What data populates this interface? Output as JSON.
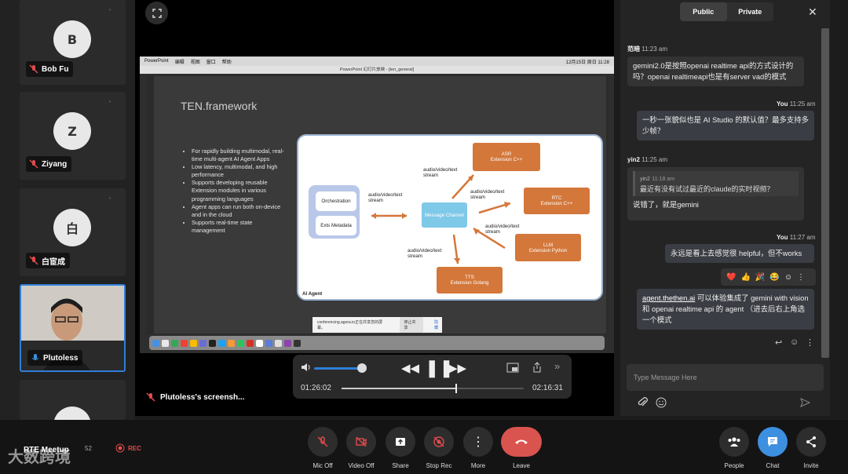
{
  "participants": [
    {
      "initial": "B",
      "name": "Bob Fu"
    },
    {
      "initial": "Z",
      "name": "Ziyang"
    },
    {
      "initial": "白",
      "name": "白宦成"
    },
    {
      "initial": "",
      "name": "Plutoless"
    }
  ],
  "slide": {
    "mac_menu": [
      "PowerPoint",
      "编辑",
      "视图",
      "窗口",
      "帮助"
    ],
    "mac_clock": "12月15日 周日 11:28",
    "window_title": "PowerPoint 幻灯片放映 - [ten_general]",
    "title": "TEN.framework",
    "bullets": [
      "For rapidly building multimodal, real-time multi-agent AI Agent Apps",
      "Low latency, multimodal, and high performance",
      "Supports developing reusable Extension modules in various programming languages",
      "Agent apps can run both on-device and in the cloud",
      "Supports real-time state management"
    ],
    "diagram": {
      "orchestration": "Orchestration",
      "exts_metadata": "Exts Metadata",
      "message_channel": "Message Channel",
      "asr": "ASR",
      "asr_sub": "Extension C++",
      "rtc": "RTC",
      "rtc_sub": "Extension C++",
      "llm": "LLM",
      "llm_sub": "Extension Python",
      "tts": "TTS",
      "tts_sub": "Extension Golang",
      "stream_label": "audio/video/text stream",
      "agent_label": "AI Agent"
    },
    "toast_text": "conferencing.agora.io正在共享您的屏幕。",
    "toast_stop": "停止共享",
    "toast_hide": "隐藏"
  },
  "media": {
    "elapsed": "01:26:02",
    "total": "02:16:31",
    "volume_percent": 80,
    "progress_percent": 62
  },
  "share_label": "Plutoless's screensh...",
  "chat": {
    "tab_public": "Public",
    "tab_private": "Private",
    "messages": [
      {
        "sender": "范暗",
        "time": "11:23 am",
        "text": "gemini2.0是按照openai realtime api的方式设计的吗？openai realtimeapi也是有server vad的模式"
      },
      {
        "sender": "You",
        "time": "11:25 am",
        "text": "一秒一张貌似也是 AI Studio 的默认值？最多支持多少帧？"
      },
      {
        "sender": "yin2",
        "time": "11:25 am",
        "quote_sender": "yin2",
        "quote_time": "11:18 am",
        "quote": "最近有没有试过最近的claude的实时视频？",
        "text": "说错了，就是gemini"
      },
      {
        "sender": "You",
        "time": "11:27 am",
        "text": "永远是看上去感觉很 helpful，但不works"
      },
      {
        "link": "agent.thethen.ai",
        "text": " 可以体验集成了 gemini with vision 和 openai realtime api 的 agent （进去后右上角选一个模式"
      }
    ],
    "reactions": [
      "❤️",
      "👍",
      "🎉",
      "😂",
      "☺",
      "⋮"
    ],
    "input_placeholder": "Type Message Here"
  },
  "bottom": {
    "meeting_name": "RTE Meetup",
    "participant_count": "52",
    "rec_label": "REC",
    "watermark": "大数跨境",
    "buttons": [
      "Mic Off",
      "Video Off",
      "Share",
      "Stop Rec",
      "More",
      "Leave"
    ],
    "right_buttons": [
      "People",
      "Chat",
      "Invite"
    ]
  },
  "colors": {
    "accent": "#3d8fe0",
    "leave": "#d9534f",
    "orange": "#d4773a",
    "channel": "#7ec8e8"
  }
}
